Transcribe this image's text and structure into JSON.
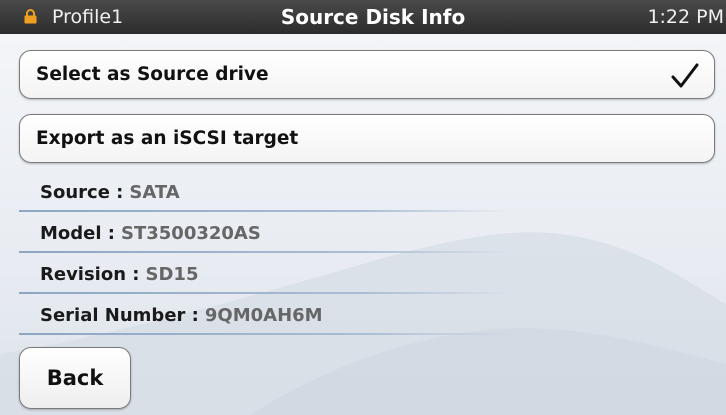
{
  "status_bar": {
    "profile": "Profile1",
    "title": "Source Disk Info",
    "time": "1:22 PM",
    "lock_icon": "lock-icon",
    "lock_color": "#f0a020"
  },
  "options": {
    "select_source": {
      "label": "Select as Source drive",
      "checked": true,
      "check_icon": "checkmark-icon"
    },
    "export_iscsi": {
      "label": "Export as an iSCSI target"
    }
  },
  "info": {
    "source": {
      "key": "Source :",
      "value": "SATA"
    },
    "model": {
      "key": "Model :",
      "value": "ST3500320AS"
    },
    "revision": {
      "key": "Revision :",
      "value": "SD15"
    },
    "serial": {
      "key": "Serial Number :",
      "value": "9QM0AH6M"
    }
  },
  "back_button": {
    "label": "Back"
  }
}
